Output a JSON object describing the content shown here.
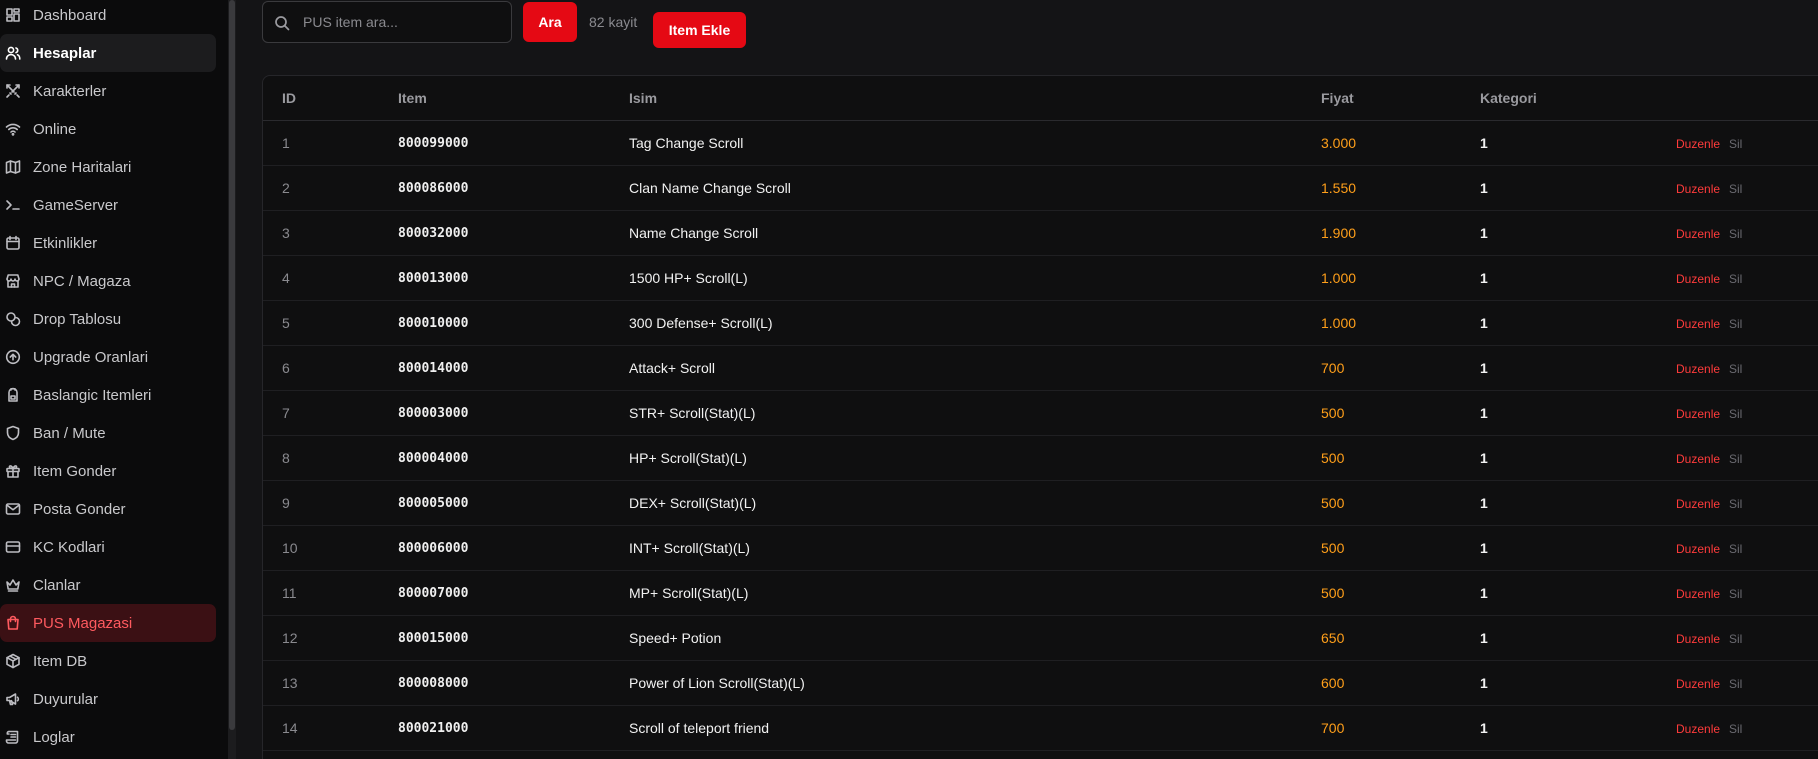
{
  "sidebar": {
    "items": [
      {
        "label": "Dashboard",
        "icon": "dashboard-icon",
        "state": ""
      },
      {
        "label": "Hesaplar",
        "icon": "users-icon",
        "state": "active-light"
      },
      {
        "label": "Karakterler",
        "icon": "swords-icon",
        "state": ""
      },
      {
        "label": "Online",
        "icon": "wifi-icon",
        "state": ""
      },
      {
        "label": "Zone Haritalari",
        "icon": "map-icon",
        "state": ""
      },
      {
        "label": "GameServer",
        "icon": "terminal-icon",
        "state": ""
      },
      {
        "label": "Etkinlikler",
        "icon": "calendar-icon",
        "state": ""
      },
      {
        "label": "NPC / Magaza",
        "icon": "store-icon",
        "state": ""
      },
      {
        "label": "Drop Tablosu",
        "icon": "coins-icon",
        "state": ""
      },
      {
        "label": "Upgrade Oranlari",
        "icon": "arrow-up-circle-icon",
        "state": ""
      },
      {
        "label": "Baslangic Itemleri",
        "icon": "backpack-icon",
        "state": ""
      },
      {
        "label": "Ban / Mute",
        "icon": "shield-icon",
        "state": ""
      },
      {
        "label": "Item Gonder",
        "icon": "gift-icon",
        "state": ""
      },
      {
        "label": "Posta Gonder",
        "icon": "mail-icon",
        "state": ""
      },
      {
        "label": "KC Kodlari",
        "icon": "card-icon",
        "state": ""
      },
      {
        "label": "Clanlar",
        "icon": "crown-icon",
        "state": ""
      },
      {
        "label": "PUS Magazasi",
        "icon": "shopping-bag-icon",
        "state": "active-red"
      },
      {
        "label": "Item DB",
        "icon": "package-icon",
        "state": ""
      },
      {
        "label": "Duyurular",
        "icon": "megaphone-icon",
        "state": ""
      },
      {
        "label": "Loglar",
        "icon": "scroll-icon",
        "state": ""
      }
    ]
  },
  "toolbar": {
    "search_placeholder": "PUS item ara...",
    "search_value": "",
    "search_button": "Ara",
    "count_label": "82 kayit",
    "add_button": "Item Ekle"
  },
  "table": {
    "headers": {
      "id": "ID",
      "item": "Item",
      "name": "Isim",
      "price": "Fiyat",
      "category": "Kategori"
    },
    "edit_label": "Duzenle",
    "delete_label": "Sil",
    "rows": [
      {
        "id": "1",
        "item": "800099000",
        "name": "Tag Change Scroll",
        "price": "3.000",
        "category": "1"
      },
      {
        "id": "2",
        "item": "800086000",
        "name": "Clan Name Change Scroll",
        "price": "1.550",
        "category": "1"
      },
      {
        "id": "3",
        "item": "800032000",
        "name": "Name Change Scroll",
        "price": "1.900",
        "category": "1"
      },
      {
        "id": "4",
        "item": "800013000",
        "name": "1500 HP+ Scroll(L)",
        "price": "1.000",
        "category": "1"
      },
      {
        "id": "5",
        "item": "800010000",
        "name": "300 Defense+ Scroll(L)",
        "price": "1.000",
        "category": "1"
      },
      {
        "id": "6",
        "item": "800014000",
        "name": "Attack+ Scroll",
        "price": "700",
        "category": "1"
      },
      {
        "id": "7",
        "item": "800003000",
        "name": "STR+ Scroll(Stat)(L)",
        "price": "500",
        "category": "1"
      },
      {
        "id": "8",
        "item": "800004000",
        "name": "HP+ Scroll(Stat)(L)",
        "price": "500",
        "category": "1"
      },
      {
        "id": "9",
        "item": "800005000",
        "name": "DEX+ Scroll(Stat)(L)",
        "price": "500",
        "category": "1"
      },
      {
        "id": "10",
        "item": "800006000",
        "name": "INT+ Scroll(Stat)(L)",
        "price": "500",
        "category": "1"
      },
      {
        "id": "11",
        "item": "800007000",
        "name": "MP+ Scroll(Stat)(L)",
        "price": "500",
        "category": "1"
      },
      {
        "id": "12",
        "item": "800015000",
        "name": "Speed+ Potion",
        "price": "650",
        "category": "1"
      },
      {
        "id": "13",
        "item": "800008000",
        "name": "Power of Lion Scroll(Stat)(L)",
        "price": "600",
        "category": "1"
      },
      {
        "id": "14",
        "item": "800021000",
        "name": "Scroll of teleport friend",
        "price": "700",
        "category": "1"
      }
    ]
  },
  "colors": {
    "accent_red": "#e50914",
    "price_orange": "#ff9f1a",
    "edit_red": "#ff3b3b"
  }
}
